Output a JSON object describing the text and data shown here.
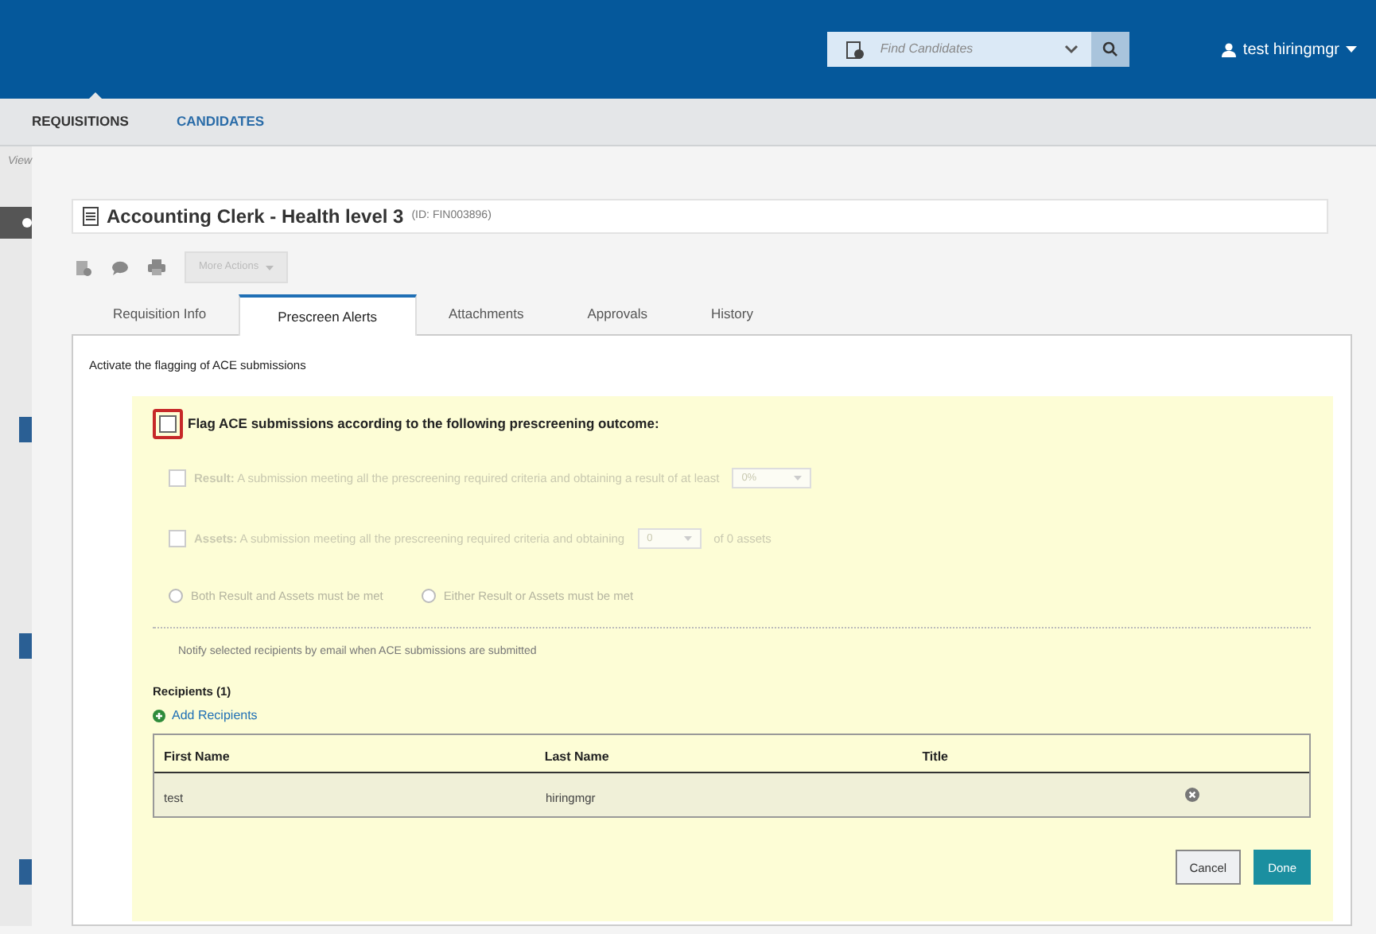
{
  "header": {
    "search": {
      "placeholder": "Find Candidates"
    },
    "user": "test hiringmgr"
  },
  "nav": [
    {
      "label": "REQUISITIONS",
      "selected": true
    },
    {
      "label": "CANDIDATES",
      "selected": false
    }
  ],
  "breadcrumb": "View",
  "requisition": {
    "title": "Accounting Clerk - Health level 3",
    "id": "(ID: FIN003896)"
  },
  "toolbar": {
    "more_actions": "More Actions",
    "disabled": true
  },
  "tabs": [
    {
      "label": "Requisition Info",
      "selected": false
    },
    {
      "label": "Prescreen Alerts",
      "selected": true
    },
    {
      "label": "Attachments",
      "selected": false
    },
    {
      "label": "Approvals",
      "selected": false
    },
    {
      "label": "History",
      "selected": false
    }
  ],
  "section_heading": "Activate the flagging of ACE submissions",
  "flag": {
    "label": "Flag ACE submissions according to the following prescreening outcome:",
    "checked": false
  },
  "criteria": [
    {
      "text": "**Result:** A submission meeting all the prescreening required criteria and obtaining a result of at least",
      "select": "0%",
      "checked": false,
      "disabled": true
    },
    {
      "text": "**Assets:** A submission meeting all the prescreening required criteria and obtaining",
      "select": "0",
      "after": "of 0 assets",
      "checked": false,
      "disabled": true
    }
  ],
  "match_options": [
    {
      "label": "Both Result and Assets must be met",
      "selected": false,
      "disabled": true
    },
    {
      "label": "Either Result or Assets must be met",
      "selected": false,
      "disabled": true
    }
  ],
  "notify_text": "Notify selected recipients by email when ACE submissions are submitted",
  "recipients": {
    "heading": "Recipients (1)",
    "add": "Add Recipients",
    "columns": [
      "First Name",
      "Last Name",
      "Title"
    ],
    "rows": [
      [
        "test",
        "hiringmgr",
        ""
      ]
    ]
  },
  "buttons": [
    {
      "label": "Cancel",
      "kind": "secondary"
    },
    {
      "label": "Done",
      "kind": "primary"
    }
  ]
}
